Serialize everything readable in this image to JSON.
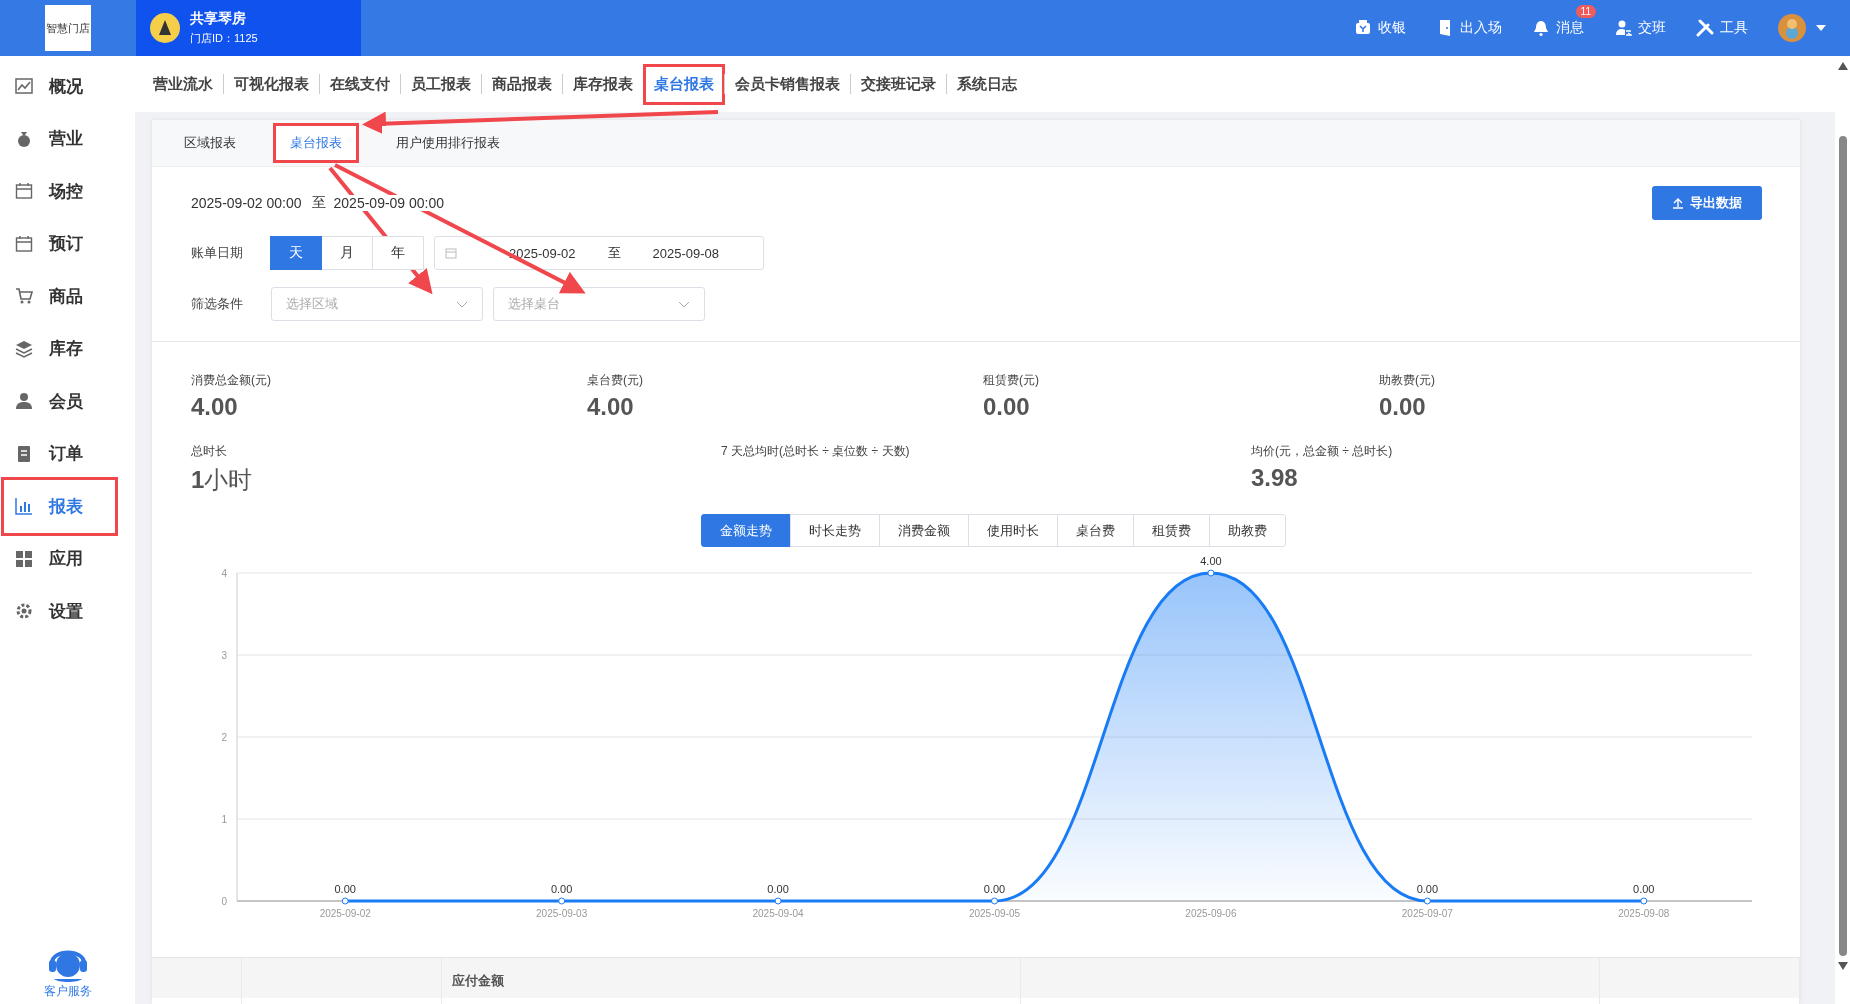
{
  "brand": {
    "logo": "智慧门店",
    "store_name": "共享琴房",
    "store_id": "门店ID：1125"
  },
  "header_actions": [
    {
      "label": "收银"
    },
    {
      "label": "出入场"
    },
    {
      "label": "消息",
      "badge": "11"
    },
    {
      "label": "交班"
    },
    {
      "label": "工具"
    }
  ],
  "sidebar": {
    "items": [
      {
        "label": "概况",
        "selected": false,
        "highlighted": false
      },
      {
        "label": "营业",
        "selected": false,
        "highlighted": false
      },
      {
        "label": "场控",
        "selected": false,
        "highlighted": false
      },
      {
        "label": "预订",
        "selected": false,
        "highlighted": false
      },
      {
        "label": "商品",
        "selected": false,
        "highlighted": false
      },
      {
        "label": "库存",
        "selected": false,
        "highlighted": false
      },
      {
        "label": "会员",
        "selected": false,
        "highlighted": false
      },
      {
        "label": "订单",
        "selected": false,
        "highlighted": false
      },
      {
        "label": "报表",
        "selected": true,
        "highlighted": true
      },
      {
        "label": "应用",
        "selected": false,
        "highlighted": false
      },
      {
        "label": "设置",
        "selected": false,
        "highlighted": false
      }
    ],
    "support": "客户服务"
  },
  "tabs": [
    {
      "label": "营业流水",
      "selected": false,
      "highlighted": false
    },
    {
      "label": "可视化报表",
      "selected": false,
      "highlighted": false
    },
    {
      "label": "在线支付",
      "selected": false,
      "highlighted": false
    },
    {
      "label": "员工报表",
      "selected": false,
      "highlighted": false
    },
    {
      "label": "商品报表",
      "selected": false,
      "highlighted": false
    },
    {
      "label": "库存报表",
      "selected": false,
      "highlighted": false
    },
    {
      "label": "桌台报表",
      "selected": true,
      "highlighted": true
    },
    {
      "label": "会员卡销售报表",
      "selected": false,
      "highlighted": false
    },
    {
      "label": "交接班记录",
      "selected": false,
      "highlighted": false
    },
    {
      "label": "系统日志",
      "selected": false,
      "highlighted": false
    }
  ],
  "sub_tabs": [
    {
      "label": "区域报表",
      "selected": false,
      "highlighted": false
    },
    {
      "label": "桌台报表",
      "selected": true,
      "highlighted": true
    },
    {
      "label": "用户使用排行报表",
      "selected": false,
      "highlighted": false
    }
  ],
  "range": {
    "start": "2025-09-02 00:00",
    "separator": "至",
    "end": "2025-09-09 00:00"
  },
  "export_button": "导出数据",
  "bill_date": {
    "label": "账单日期",
    "periods": [
      {
        "label": "天",
        "selected": true
      },
      {
        "label": "月",
        "selected": false
      },
      {
        "label": "年",
        "selected": false
      }
    ],
    "start": "2025-09-02",
    "separator": "至",
    "end": "2025-09-08"
  },
  "filter": {
    "label": "筛选条件",
    "area_placeholder": "选择区域",
    "table_placeholder": "选择桌台"
  },
  "stats": [
    {
      "label": "消费总金额(元)",
      "value": "4.00"
    },
    {
      "label": "桌台费(元)",
      "value": "4.00"
    },
    {
      "label": "租赁费(元)",
      "value": "0.00"
    },
    {
      "label": "助教费(元)",
      "value": "0.00"
    }
  ],
  "stats2": [
    {
      "label": "总时长",
      "value": "1",
      "unit": "小时"
    },
    {
      "label": "7 天总均时(总时长 ÷ 桌位数 ÷ 天数)"
    },
    {
      "label": "均价(元，总金额 ÷ 总时长)",
      "value": "3.98"
    }
  ],
  "chart_tabs": [
    {
      "label": "金额走势",
      "selected": true
    },
    {
      "label": "时长走势",
      "selected": false
    },
    {
      "label": "消费金额",
      "selected": false
    },
    {
      "label": "使用时长",
      "selected": false
    },
    {
      "label": "桌台费",
      "selected": false
    },
    {
      "label": "租赁费",
      "selected": false
    },
    {
      "label": "助教费",
      "selected": false
    }
  ],
  "chart_data": {
    "type": "area",
    "categories": [
      "2025-09-02",
      "2025-09-03",
      "2025-09-04",
      "2025-09-05",
      "2025-09-06",
      "2025-09-07",
      "2025-09-08"
    ],
    "series": [
      {
        "color": "#1a7cf5",
        "values": [
          0,
          0,
          0,
          0,
          4,
          0,
          0
        ]
      }
    ],
    "ylim": [
      0,
      4
    ],
    "yticks": [
      0,
      1,
      2,
      3,
      4
    ],
    "grid": true,
    "value_labels": [
      "0.00",
      "0.00",
      "0.00",
      "0.00",
      "4.00",
      "0.00",
      "0.00"
    ]
  },
  "table": {
    "columns": [
      "应付金额"
    ]
  }
}
